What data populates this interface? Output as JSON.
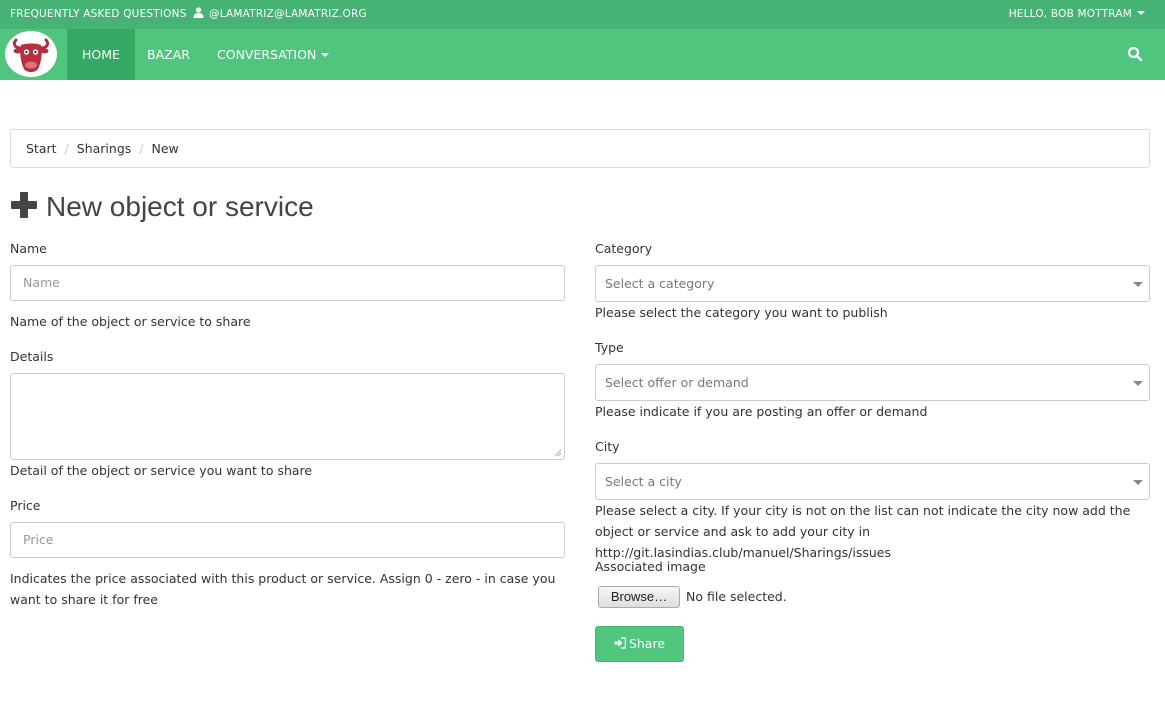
{
  "topbar": {
    "faq": "FREQUENTLY ASKED QUESTIONS",
    "email": "@LAMATRIZ@LAMATRIZ.ORG",
    "user_menu": "HELLO, BOB MOTTRAM"
  },
  "nav": {
    "home": "HOME",
    "bazar": "BAZAR",
    "conversation": "CONVERSATION"
  },
  "breadcrumb": {
    "items": [
      "Start",
      "Sharings",
      "New"
    ],
    "separator": "/"
  },
  "page": {
    "title": "New object or service"
  },
  "form": {
    "name": {
      "label": "Name",
      "placeholder": "Name",
      "help": "Name of the object or service to share"
    },
    "details": {
      "label": "Details",
      "help": "Detail of the object or service you want to share"
    },
    "price": {
      "label": "Price",
      "placeholder": "Price",
      "help": "Indicates the price associated with this product or service. Assign 0 - zero - in case you want to share it for free"
    },
    "category": {
      "label": "Category",
      "placeholder": "Select a category",
      "help": "Please select the category you want to publish"
    },
    "type": {
      "label": "Type",
      "placeholder": "Select offer or demand",
      "help": "Please indicate if you are posting an offer or demand"
    },
    "city": {
      "label": "City",
      "placeholder": "Select a city",
      "help": "Please select a city. If your city is not on the list can not indicate the city now add the object or service and ask to add your city in http://git.lasindias.club/manuel/Sharings/issues"
    },
    "image": {
      "label": "Associated image",
      "browse": "Browse…",
      "status": "No file selected."
    },
    "submit": "Share"
  },
  "colors": {
    "topbar": "#46b374",
    "navbar": "#50c57e",
    "nav_active": "#33a963",
    "button": "#50c57e"
  }
}
